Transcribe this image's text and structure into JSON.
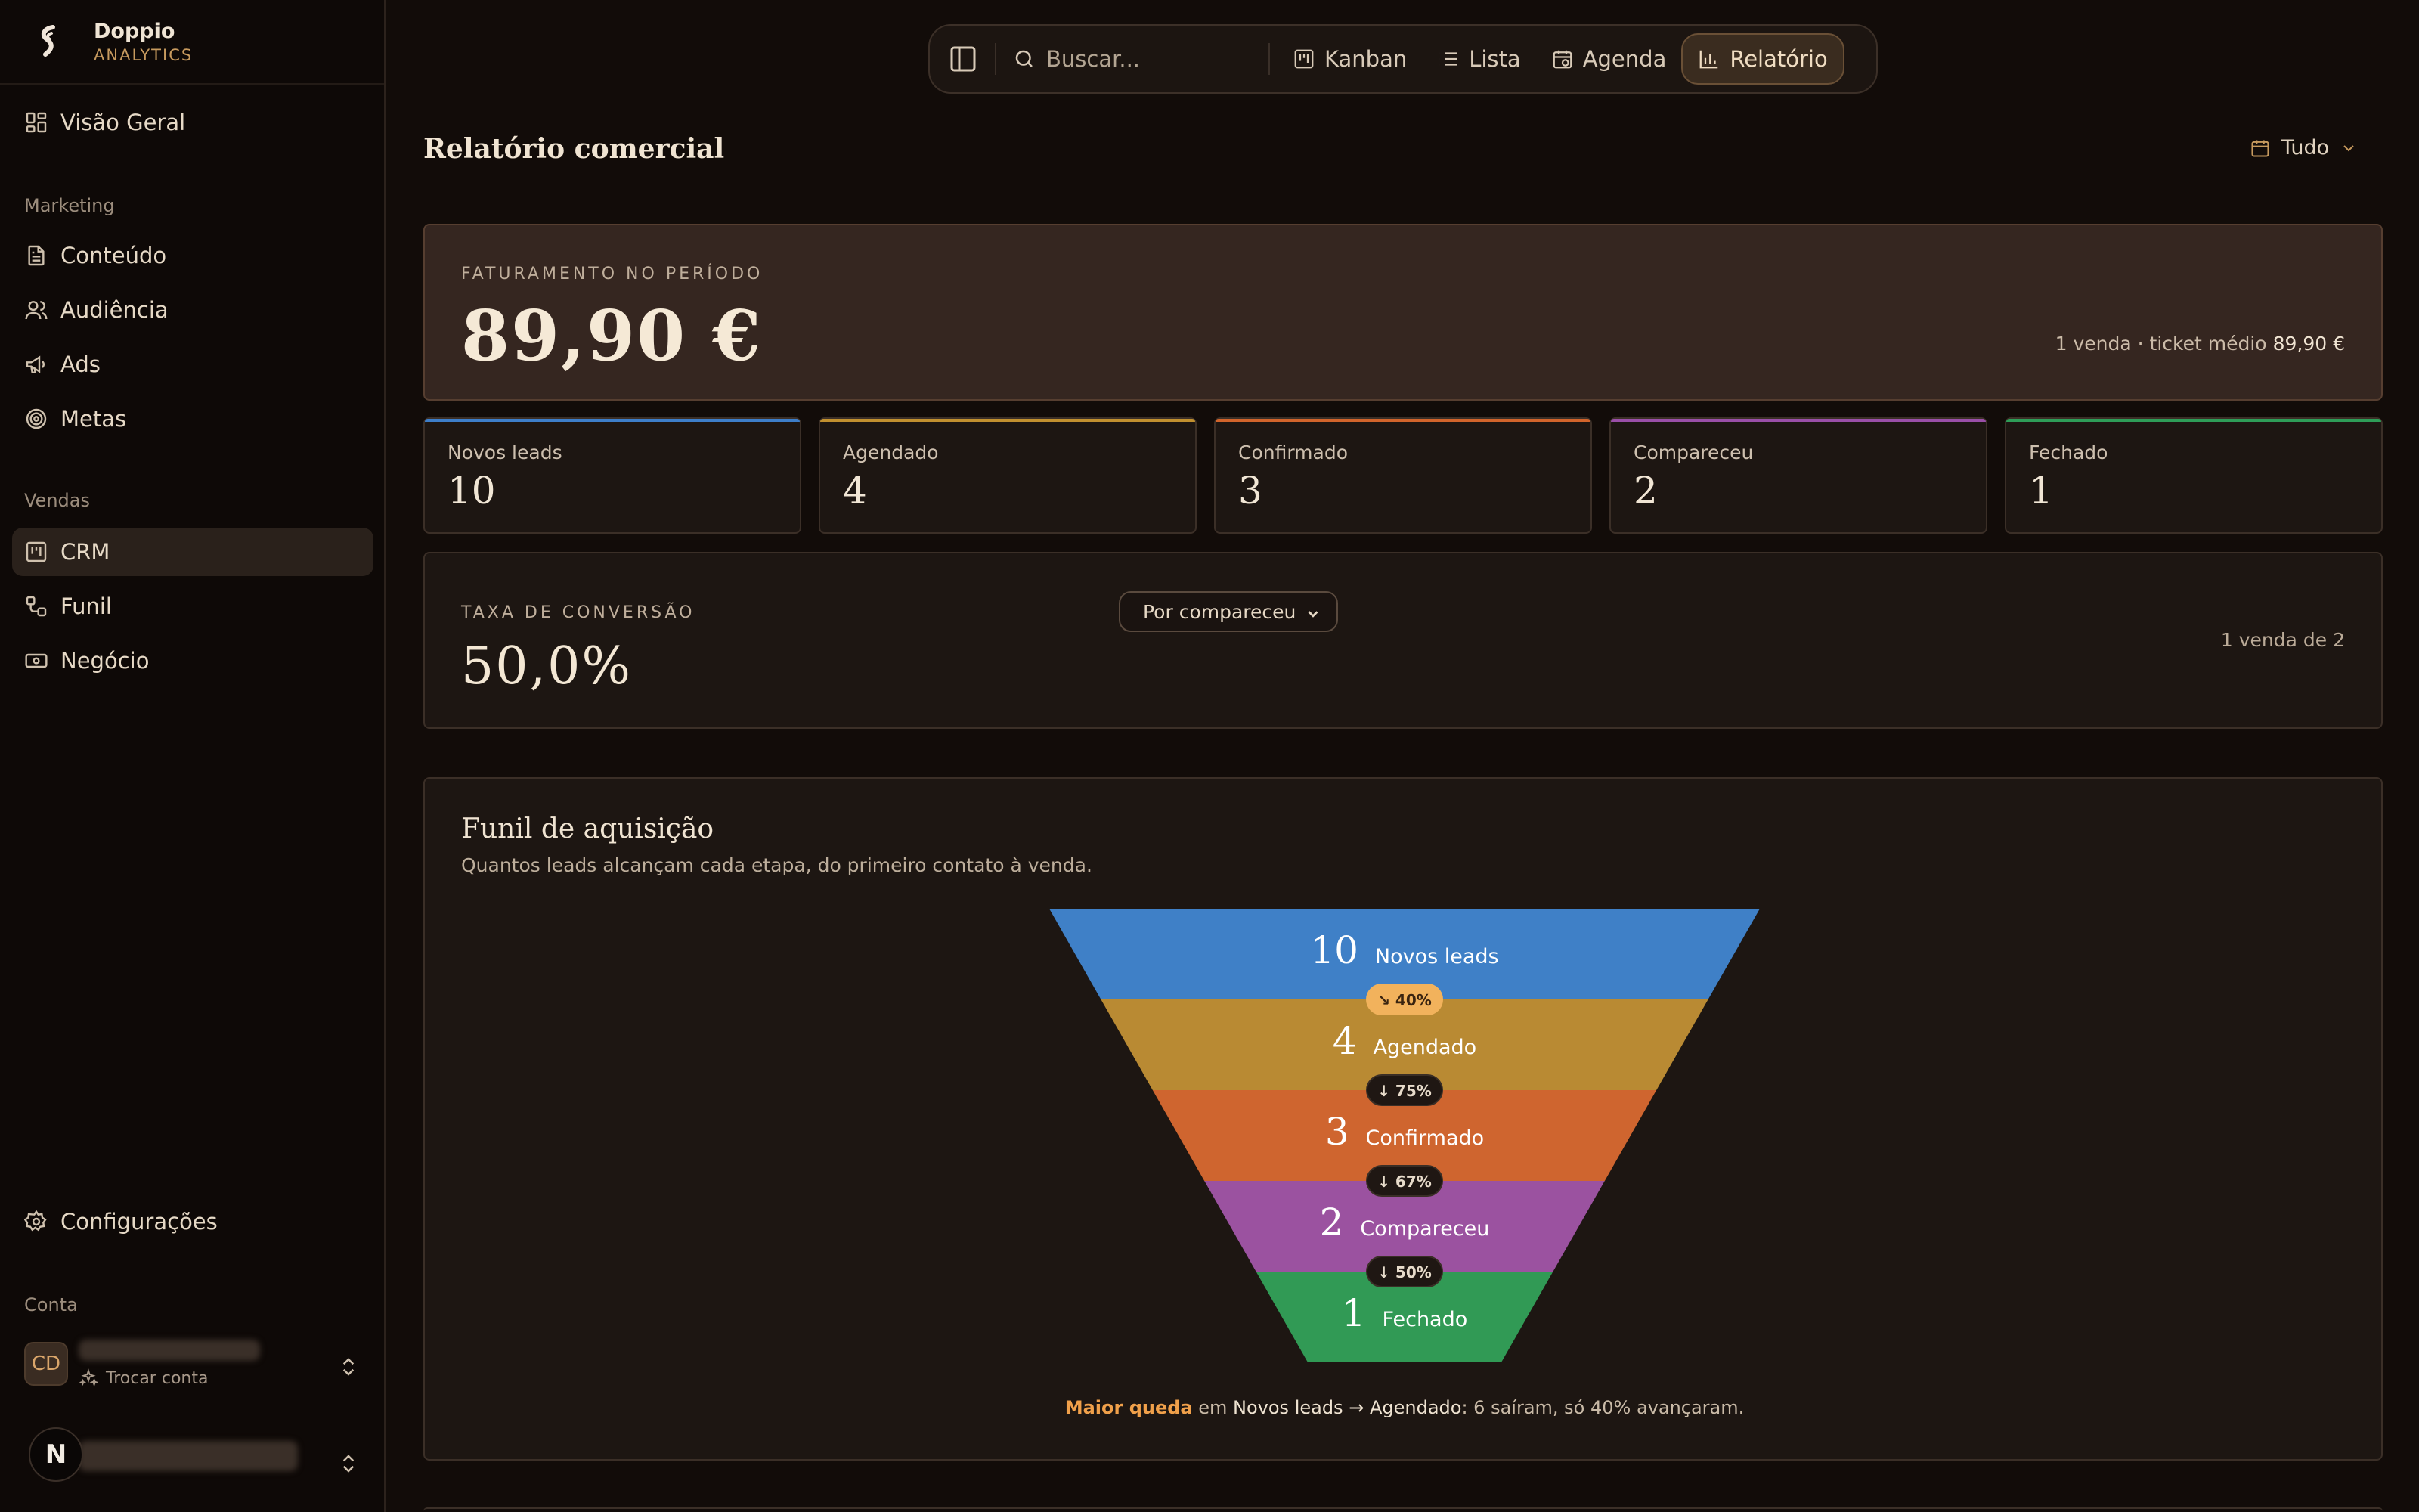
{
  "brand": {
    "name": "Doppio",
    "sub": "ANALYTICS"
  },
  "sidebar": {
    "overview": "Visão Geral",
    "marketing_label": "Marketing",
    "marketing": [
      "Conteúdo",
      "Audiência",
      "Ads",
      "Metas"
    ],
    "sales_label": "Vendas",
    "sales": [
      "CRM",
      "Funil",
      "Negócio"
    ],
    "settings": "Configurações",
    "account_label": "Conta",
    "avatar_initials": "CD",
    "switch_account": "Trocar conta",
    "n_avatar": "N"
  },
  "topbar": {
    "search_placeholder": "Buscar...",
    "tabs": [
      "Kanban",
      "Lista",
      "Agenda",
      "Relatório"
    ],
    "active_tab": "Relatório"
  },
  "page": {
    "title": "Relatório comercial",
    "period": "Tudo"
  },
  "revenue": {
    "label": "FATURAMENTO NO PERÍODO",
    "value": "89,90 €",
    "note_prefix": "1 venda · ticket médio",
    "note_value": "89,90 €"
  },
  "stats": [
    {
      "label": "Novos leads",
      "value": "10",
      "color": "#3d7ec9"
    },
    {
      "label": "Agendado",
      "value": "4",
      "color": "#c1902f"
    },
    {
      "label": "Confirmado",
      "value": "3",
      "color": "#d2642b"
    },
    {
      "label": "Compareceu",
      "value": "2",
      "color": "#9a4fa8"
    },
    {
      "label": "Fechado",
      "value": "1",
      "color": "#2e9d58"
    }
  ],
  "conversion": {
    "label": "TAXA DE CONVERSÃO",
    "select": "Por compareceu",
    "value": "50,0%",
    "note": "1 venda de 2"
  },
  "funnel": {
    "title": "Funil de aquisição",
    "description": "Quantos leads alcançam cada etapa, do primeiro contato à venda.",
    "stages": [
      {
        "value": "10",
        "label": "Novos leads",
        "color": "#3f80c7"
      },
      {
        "value": "4",
        "label": "Agendado",
        "color": "#b98a33"
      },
      {
        "value": "3",
        "label": "Confirmado",
        "color": "#cf652f"
      },
      {
        "value": "2",
        "label": "Compareceu",
        "color": "#9b52a0"
      },
      {
        "value": "1",
        "label": "Fechado",
        "color": "#319a55"
      }
    ],
    "drops": [
      "40%",
      "75%",
      "67%",
      "50%"
    ],
    "footer": {
      "highlight": "Maior queda",
      "text1": " em ",
      "stage_from": "Novos leads",
      "arrow": " → ",
      "stage_to": "Agendado",
      "text2": ": 6 saíram, só 40% avançaram."
    }
  }
}
